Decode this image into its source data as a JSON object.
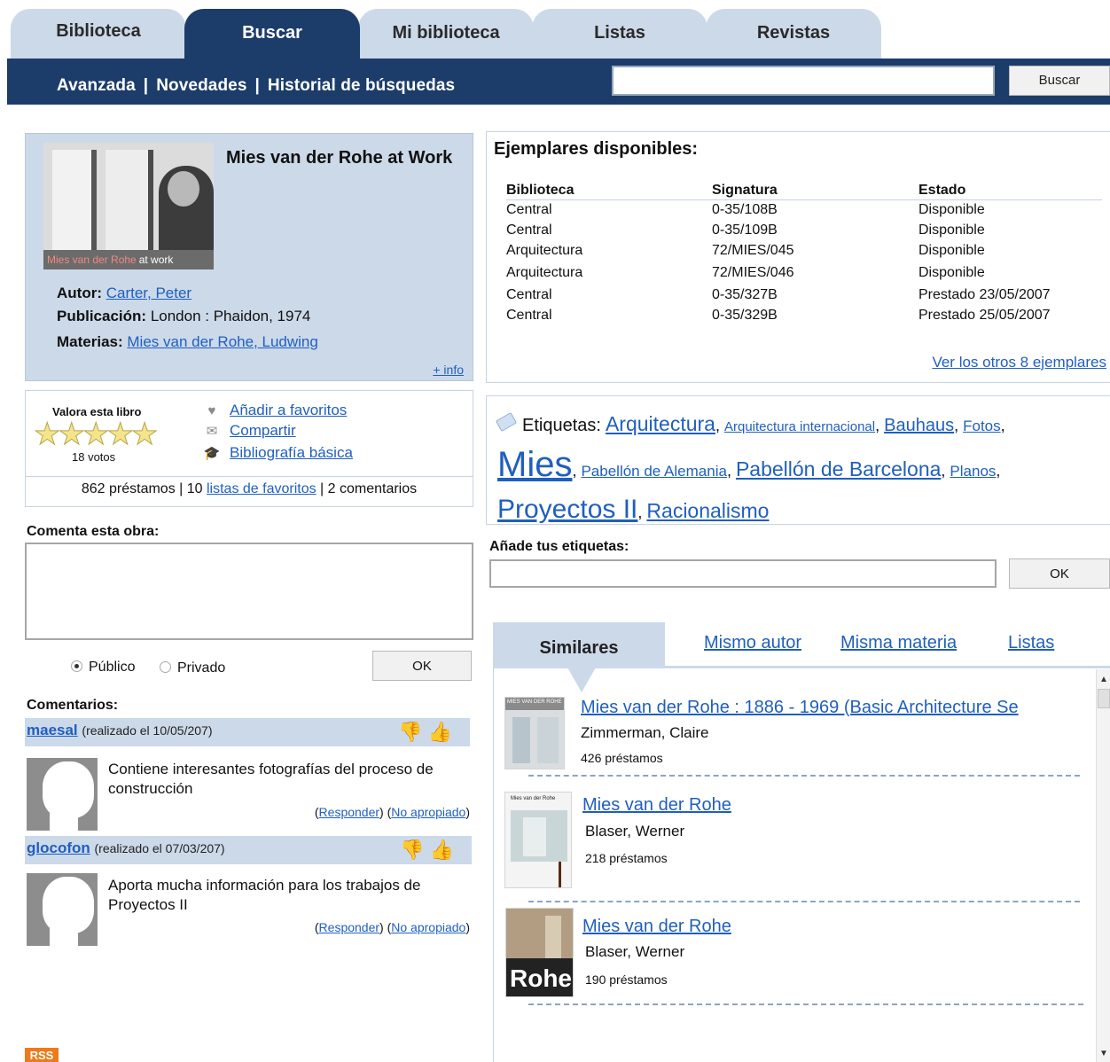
{
  "tabs": [
    "Biblioteca",
    "Buscar",
    "Mi biblioteca",
    "Listas",
    "Revistas"
  ],
  "subnav": [
    "Avanzada",
    "Novedades",
    "Historial de búsquedas"
  ],
  "search": {
    "button": "Buscar",
    "value": ""
  },
  "book": {
    "cover_text_a": "Mies van der Rohe",
    "cover_text_b": "at work",
    "title": "Mies van der Rohe at Work",
    "author_label": "Autor:",
    "author": "Carter, Peter",
    "pub_label": "Publicación:",
    "publication": "London : Phaidon, 1974",
    "subjects_label": "Materias:",
    "subjects": "Mies van der Rohe, Ludwing",
    "more_info": "+ info"
  },
  "rating": {
    "title": "Valora esta libro",
    "stars": "★★★★★",
    "votes": "18 votos",
    "actions": [
      "Añadir a favoritos",
      "Compartir",
      "Bibliografía básica"
    ],
    "loans": "862 préstamos | 10 ",
    "lists_link": "listas de favoritos",
    "comments_count": " | 2 comentarios"
  },
  "comment_form": {
    "label": "Comenta esta obra:",
    "value": "",
    "public": "Público",
    "private": "Privado",
    "ok": "OK"
  },
  "comments": {
    "label": "Comentarios:",
    "items": [
      {
        "user": "maesal",
        "date": "(realizado el 10/05/207)",
        "text": "Contiene interesantes fotografías del proceso de construcción",
        "reply": "Responder",
        "report": "No apropiado"
      },
      {
        "user": "glocofon",
        "date": "(realizado el 07/03/207)",
        "text": "Aporta mucha información para los trabajos de Proyectos II",
        "reply": "Responder",
        "report": "No apropiado"
      }
    ]
  },
  "rss": "RSS",
  "copies": {
    "title": "Ejemplares disponibles:",
    "headers": [
      "Biblioteca",
      "Signatura",
      "Estado"
    ],
    "rows": [
      [
        "Central",
        "0-35/108B",
        "Disponible"
      ],
      [
        "Central",
        "0-35/109B",
        "Disponible"
      ],
      [
        "Arquitectura",
        "72/MIES/045",
        "Disponible"
      ],
      [
        "Arquitectura",
        "72/MIES/046",
        "Disponible"
      ],
      [
        "Central",
        "0-35/327B",
        "Prestado 23/05/2007"
      ],
      [
        "Central",
        "0-35/329B",
        "Prestado 25/05/2007"
      ]
    ],
    "more": "Ver los otros 8 ejemplares"
  },
  "tags": {
    "lead": "Etiquetas:",
    "items": [
      "Arquitectura",
      "Arquitectura internacional",
      "Bauhaus",
      "Fotos",
      "Mies",
      "Pabellón de Alemania",
      "Pabellón de Barcelona",
      "Planos",
      "Proyectos II",
      "Racionalismo"
    ],
    "add_label": "Añade tus etiquetas:",
    "add_value": "",
    "ok": "OK"
  },
  "similar": {
    "tabs": [
      "Similares",
      "Mismo autor",
      "Misma materia",
      "Listas"
    ],
    "items": [
      {
        "title": "Mies van der Rohe : 1886 - 1969 (Basic Architecture Se",
        "author": "Zimmerman, Claire",
        "loans": "426 préstamos",
        "cover_text": "MIES VAN DER ROHE"
      },
      {
        "title": "Mies van der Rohe",
        "author": "Blaser, Werner",
        "loans": "218 préstamos",
        "cover_text": "Mies van der Rohe"
      },
      {
        "title": "Mies van der Rohe",
        "author": "Blaser, Werner",
        "loans": "190 préstamos",
        "cover_text": "Rohe"
      }
    ]
  }
}
